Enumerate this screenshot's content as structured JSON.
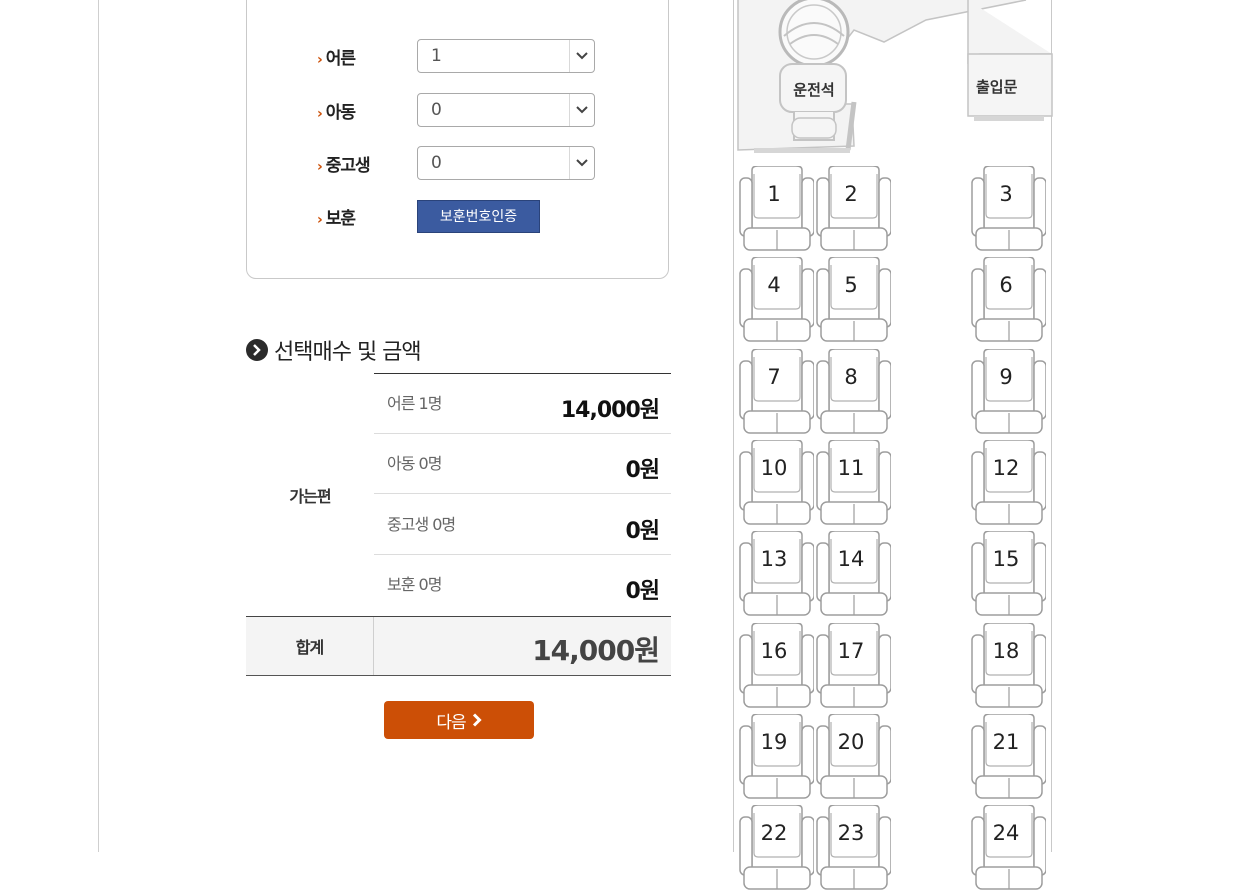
{
  "passengers": {
    "rows": [
      {
        "label": "어른",
        "value": "1"
      },
      {
        "label": "아동",
        "value": "0"
      },
      {
        "label": "중고생",
        "value": "0"
      }
    ],
    "veteran": {
      "label": "보훈",
      "button": "보훈번호인증"
    }
  },
  "summary": {
    "title": "선택매수 및 금액",
    "direction": "가는편",
    "items": [
      {
        "label": "어른 1명",
        "amount": "14,000원"
      },
      {
        "label": "아동 0명",
        "amount": "0원"
      },
      {
        "label": "중고생 0명",
        "amount": "0원"
      },
      {
        "label": "보훈 0명",
        "amount": "0원"
      }
    ],
    "total_label": "합계",
    "total_amount": "14,000원"
  },
  "next_button": "다음",
  "bus": {
    "driver_label": "운전석",
    "door_label": "출입문",
    "seats": [
      "1",
      "2",
      "3",
      "4",
      "5",
      "6",
      "7",
      "8",
      "9",
      "10",
      "11",
      "12",
      "13",
      "14",
      "15",
      "16",
      "17",
      "18",
      "19",
      "20",
      "21",
      "22",
      "23",
      "24"
    ]
  },
  "colors": {
    "accent": "#cc4f06",
    "cert_button": "#3b5ba0"
  }
}
